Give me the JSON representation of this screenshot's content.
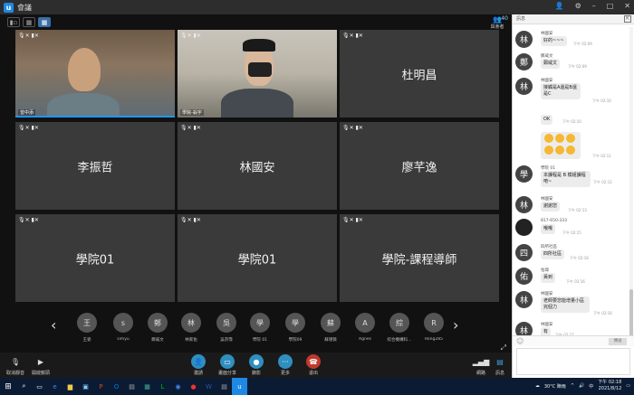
{
  "window": {
    "title": "會議",
    "logo": "u"
  },
  "meeting": {
    "attendees_label": "與會者",
    "attendees_count": "40",
    "tiles": [
      {
        "name": "",
        "label": "曾中添",
        "type": "video"
      },
      {
        "name": "",
        "label": "學院-翁宇",
        "type": "video"
      },
      {
        "name": "杜明昌",
        "label": "",
        "type": "name"
      },
      {
        "name": "李振哲",
        "label": "",
        "type": "name"
      },
      {
        "name": "林國安",
        "label": "",
        "type": "name"
      },
      {
        "name": "廖芊逸",
        "label": "",
        "type": "name"
      },
      {
        "name": "學院01",
        "label": "",
        "type": "name"
      },
      {
        "name": "學院01",
        "label": "",
        "type": "name"
      },
      {
        "name": "學院-課程導師",
        "label": "",
        "type": "name"
      }
    ],
    "strip": [
      {
        "initial": "王",
        "name": "王姿"
      },
      {
        "initial": "s",
        "name": "simyu"
      },
      {
        "initial": "鄭",
        "name": "鄭威文"
      },
      {
        "initial": "林",
        "name": "林家佑"
      },
      {
        "initial": "吳",
        "name": "吳宗霈"
      },
      {
        "initial": "學",
        "name": "學院 01"
      },
      {
        "initial": "學",
        "name": "學院09"
      },
      {
        "initial": "蘇",
        "name": "蘇瑾薇"
      },
      {
        "initial": "A",
        "name": "Agnes"
      },
      {
        "initial": "綜",
        "name": "綜合機構科…"
      },
      {
        "initial": "R",
        "name": "Rong285"
      }
    ]
  },
  "toolbar": {
    "left": [
      {
        "label": "取消靜音",
        "icon": "mic-off-icon"
      },
      {
        "label": "開啟鏡頭",
        "icon": "camera-off-icon"
      }
    ],
    "center": [
      {
        "label": "邀請",
        "icon": "invite-icon",
        "color": "#2f8fbf"
      },
      {
        "label": "畫面分享",
        "icon": "share-screen-icon",
        "color": "#2f8fbf"
      },
      {
        "label": "錄影",
        "icon": "record-icon",
        "color": "#2f8fbf"
      },
      {
        "label": "更多",
        "icon": "more-icon",
        "color": "#2f8fbf"
      },
      {
        "label": "退出",
        "icon": "hangup-icon",
        "color": "#c0392b"
      }
    ],
    "right": [
      {
        "label": "網路",
        "icon": "network-icon"
      },
      {
        "label": "訊息",
        "icon": "chat-icon"
      }
    ]
  },
  "chat": {
    "title": "訊息",
    "send_label": "傳送",
    "messages": [
      {
        "avatar": "林",
        "sender": "林國安",
        "text": "好的~~~",
        "time": "下午 02:09"
      },
      {
        "avatar": "鄭",
        "sender": "鄭威文",
        "text": "鄭威文",
        "time": "下午 02:09"
      },
      {
        "avatar": "林",
        "sender": "林國安",
        "text": "接觸是A還是B還是C",
        "time": "下午 02:10"
      },
      {
        "avatar": "",
        "sender": "",
        "text": "OK",
        "time": "下午 02:10"
      },
      {
        "avatar": "",
        "sender": "",
        "text": "emoji",
        "time": "下午 02:11"
      },
      {
        "avatar": "學",
        "sender": "學院 01",
        "text": "本課程是 B 模組課程唷~",
        "time": "下午 02:12"
      },
      {
        "avatar": "林",
        "sender": "林國安",
        "text": "謝謝您",
        "time": "下午 02:13"
      },
      {
        "avatar": "",
        "sender": "817-650-333",
        "text": "哦哦",
        "time": "下午 02:15"
      },
      {
        "avatar": "四",
        "sender": "四所社區",
        "text": "四所社區",
        "time": "下午 02:16"
      },
      {
        "avatar": "佑",
        "sender": "佑瑋",
        "text": "黃到",
        "time": "下午 02:16"
      },
      {
        "avatar": "林",
        "sender": "林國安",
        "text": "老師要您能增量小區完個力",
        "time": "下午 02:16"
      },
      {
        "avatar": "林",
        "sender": "林國安",
        "text": "有",
        "time": "下午 02:17"
      }
    ]
  },
  "taskbar": {
    "weather": "30°C 陣雨",
    "time": "下午 02:18",
    "date": "2021/8/12",
    "lang": "中"
  }
}
